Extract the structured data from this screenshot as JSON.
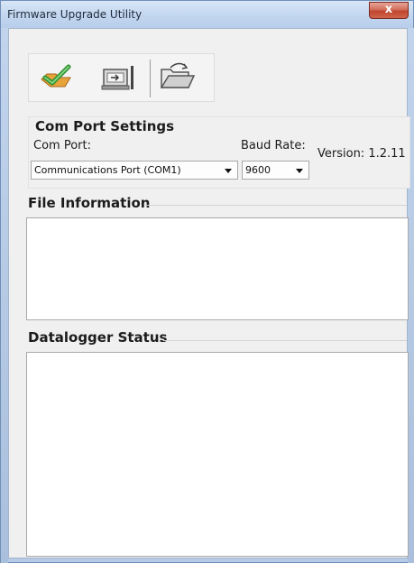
{
  "window": {
    "title": "Firmware Upgrade Utility",
    "close_label": "x"
  },
  "toolbar": {
    "buttons": [
      {
        "icon": "checkmark-hand-icon"
      },
      {
        "icon": "transfer-device-icon"
      },
      {
        "icon": "open-folder-icon"
      }
    ]
  },
  "com_port_settings": {
    "header": "Com Port Settings",
    "com_port_label": "Com Port:",
    "com_port_value": "Communications Port (COM1)",
    "baud_rate_label": "Baud Rate:",
    "baud_rate_value": "9600",
    "version": "Version: 1.2.11"
  },
  "file_information": {
    "header": "File Information",
    "content": ""
  },
  "datalogger_status": {
    "header": "Datalogger Status",
    "content": ""
  }
}
